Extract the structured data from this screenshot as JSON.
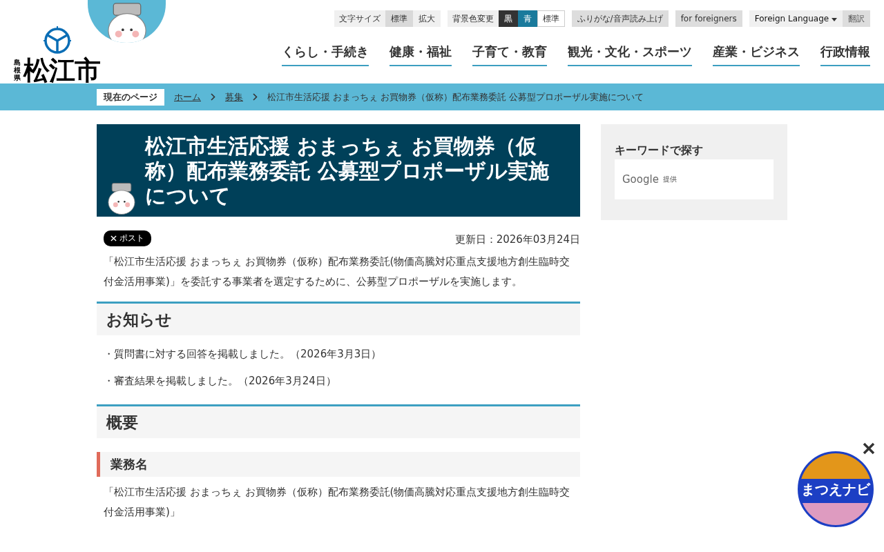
{
  "logo": {
    "prefecture": "島根県",
    "city": "松江市"
  },
  "utility": {
    "font_size": {
      "label": "文字サイズ",
      "options": [
        {
          "label": "標準",
          "selected": true
        },
        {
          "label": "拡大",
          "selected": false
        }
      ]
    },
    "background": {
      "label": "背景色変更",
      "options": [
        {
          "label": "黒",
          "color": "#333333"
        },
        {
          "label": "青",
          "color": "#1a7a9c"
        },
        {
          "label": "標準",
          "color": "#ffffff"
        }
      ]
    },
    "furigana": "ふりがな/音声読み上げ",
    "foreigners": "for foreigners",
    "language": "Foreign Language",
    "translate": "翻訳"
  },
  "nav": [
    {
      "label": "くらし・手続き"
    },
    {
      "label": "健康・福祉"
    },
    {
      "label": "子育て・教育"
    },
    {
      "label": "観光・文化・スポーツ"
    },
    {
      "label": "産業・ビジネス"
    },
    {
      "label": "行政情報"
    }
  ],
  "breadcrumb": {
    "label": "現在のページ",
    "items": [
      {
        "label": "ホーム",
        "link": true
      },
      {
        "label": "募集",
        "link": true
      },
      {
        "label": "松江市生活応援 おまっちぇ お買物券（仮称）配布業務委託 公募型プロポーザル実施について",
        "link": false
      }
    ]
  },
  "article": {
    "title": "松江市生活応援 おまっちぇ お買物券（仮称）配布業務委託 公募型プロポーザル実施について",
    "post_button": "ポスト",
    "updated": "更新日：2026年03月24日",
    "blocks": [
      {
        "kind": "paragraph",
        "text": "「松江市生活応援 おまっちぇ お買物券（仮称）配布業務委託(物価高騰対応重点支援地方創生臨時交付金活用事業)」を委託する事業者を選定するために、公募型プロポーザルを実施します。"
      },
      {
        "kind": "h2",
        "text": "お知らせ"
      },
      {
        "kind": "item",
        "text": "・質問書に対する回答を掲載しました。（2026年3月3日）"
      },
      {
        "kind": "item",
        "text": "・審査結果を掲載しました。（2026年3月24日）"
      },
      {
        "kind": "h2",
        "text": "概要"
      },
      {
        "kind": "h3",
        "text": "業務名"
      },
      {
        "kind": "paragraph",
        "text": "「松江市生活応援 おまっちぇ お買物券（仮称）配布業務委託(物価高騰対応重点支援地方創生臨時交付金活用事業)」"
      }
    ]
  },
  "sidebar": {
    "title": "キーワードで探す",
    "brand": "Google",
    "provided": "提供"
  },
  "navi_badge": {
    "label": "まつえナビ"
  }
}
